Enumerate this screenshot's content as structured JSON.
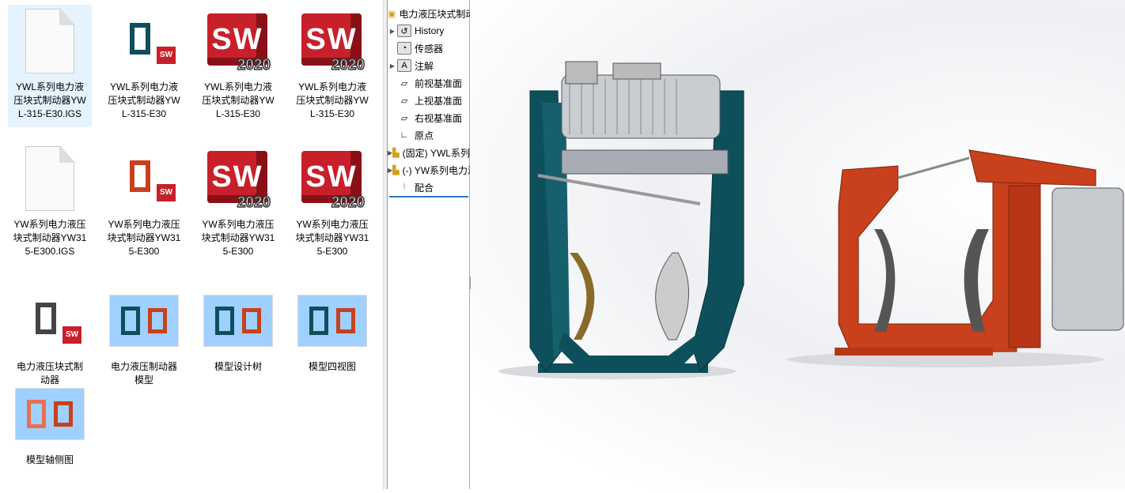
{
  "explorer": {
    "items": [
      {
        "label": "YWL系列电力液压块式制动器YWL-315-E30.IGS",
        "type": "blank-file-icon",
        "selected": true
      },
      {
        "label": "YWL系列电力液压块式制动器YWL-315-E30",
        "type": "assembly-teal-icon"
      },
      {
        "label": "YWL系列电力液压块式制动器YWL-315-E30",
        "type": "solidworks-2020-icon"
      },
      {
        "label": "YWL系列电力液压块式制动器YWL-315-E30",
        "type": "solidworks-2020-icon"
      },
      {
        "label": "YW系列电力液压块式制动器YW315-E300.IGS",
        "type": "blank-file-icon"
      },
      {
        "label": "YW系列电力液压块式制动器YW315-E300",
        "type": "assembly-red-icon"
      },
      {
        "label": "YW系列电力液压块式制动器YW315-E300",
        "type": "solidworks-2020-icon"
      },
      {
        "label": "YW系列电力液压块式制动器YW315-E300",
        "type": "solidworks-2020-icon"
      },
      {
        "label": "电力液压块式制动器",
        "type": "assembly-both-icon"
      },
      {
        "label": "电力液压制动器模型",
        "type": "image-thumbnail"
      },
      {
        "label": "模型设计树",
        "type": "image-thumbnail"
      },
      {
        "label": "模型四视图",
        "type": "image-thumbnail"
      },
      {
        "label": "模型轴侧图",
        "type": "image-thumbnail"
      }
    ],
    "sw_letters": "SW",
    "sw_year": "2020"
  },
  "tree": {
    "root": "电力液压块式制动器",
    "items": [
      {
        "label": "History",
        "icon": "history-icon",
        "expand": true
      },
      {
        "label": "传感器",
        "icon": "sensor-icon",
        "expand": false
      },
      {
        "label": "注解",
        "icon": "annotation-icon",
        "expand": true
      },
      {
        "label": "前视基准面",
        "icon": "plane-icon",
        "expand": false
      },
      {
        "label": "上视基准面",
        "icon": "plane-icon",
        "expand": false
      },
      {
        "label": "右视基准面",
        "icon": "plane-icon",
        "expand": false
      },
      {
        "label": "原点",
        "icon": "origin-icon",
        "expand": false
      },
      {
        "label": "(固定) YWL系列电力液压块式制动器",
        "icon": "part-icon",
        "expand": true
      },
      {
        "label": "(-) YW系列电力液压块式制动器",
        "icon": "part-icon",
        "expand": true
      },
      {
        "label": "配合",
        "icon": "mates-icon",
        "expand": false
      }
    ]
  },
  "colors": {
    "teal": "#0e4f5c",
    "red": "#c8401c",
    "sw_red": "#c8202a",
    "selection": "#e5f3ff",
    "tree_accent": "#2b79c2"
  }
}
